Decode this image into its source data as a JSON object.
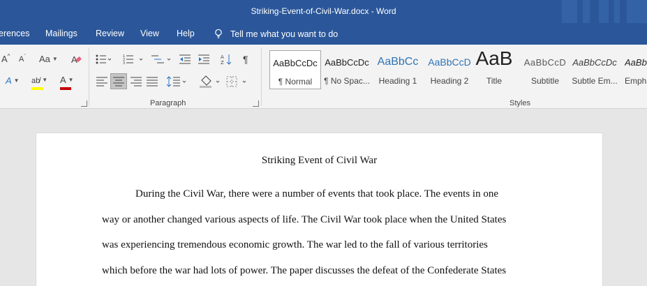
{
  "window": {
    "title": "Striking-Event-of-Civil-War.docx  -  Word"
  },
  "tabs": [
    {
      "label": "erences"
    },
    {
      "label": "Mailings"
    },
    {
      "label": "Review"
    },
    {
      "label": "View"
    },
    {
      "label": "Help"
    }
  ],
  "tell_me": {
    "placeholder": "Tell me what you want to do"
  },
  "ribbon": {
    "font_group": {
      "case_label": "Aa"
    },
    "paragraph_group": {
      "label": "Paragraph"
    },
    "styles_group": {
      "label": "Styles"
    }
  },
  "styles": [
    {
      "sample": "AaBbCcDc",
      "name": "¶ Normal"
    },
    {
      "sample": "AaBbCcDc",
      "name": "¶ No Spac..."
    },
    {
      "sample": "AaBbCc",
      "name": "Heading 1"
    },
    {
      "sample": "AaBbCcD",
      "name": "Heading 2"
    },
    {
      "sample": "AaB",
      "name": "Title"
    },
    {
      "sample": "AaBbCcD",
      "name": "Subtitle"
    },
    {
      "sample": "AaBbCcDc",
      "name": "Subtle Em..."
    },
    {
      "sample": "AaBbCc",
      "name": "Emph"
    }
  ],
  "colors": {
    "accent": "#2b579a",
    "highlight": "#ffff00",
    "font_color": "#c00000"
  },
  "document": {
    "title": "Striking Event of Civil War",
    "lines": [
      "During the Civil War, there were a number of events that took place. The events in one",
      "way or another changed various aspects of life. The Civil War took place when the United States",
      "was experiencing tremendous economic growth. The war led to the fall of various territories",
      "which before the war had lots of power. The paper discusses the defeat of the Confederate States"
    ]
  }
}
